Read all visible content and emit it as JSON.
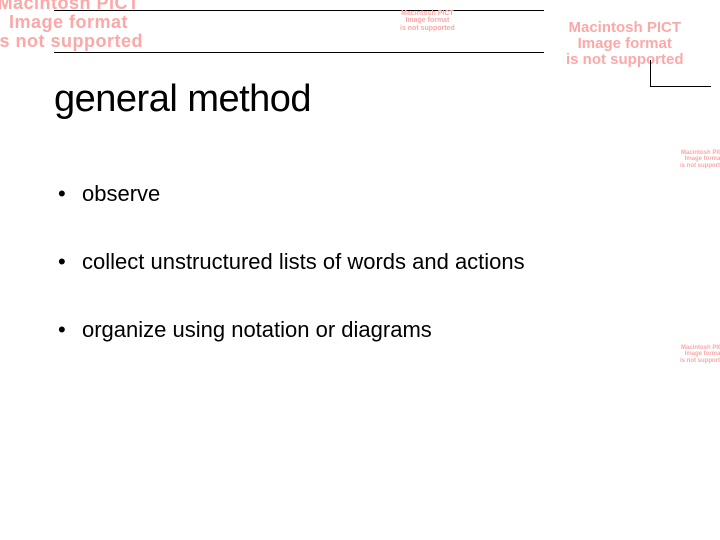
{
  "errorText": "Macintosh PICT\nImage format\nis not supported",
  "slide": {
    "title": "general method",
    "bullets": [
      "observe",
      "collect unstructured lists of words and actions",
      "organize using notation or diagrams"
    ]
  }
}
